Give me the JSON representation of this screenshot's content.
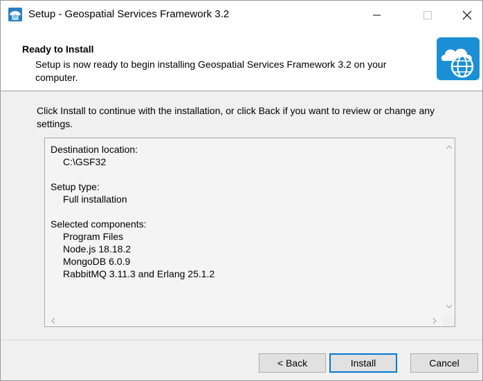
{
  "window": {
    "title": "Setup - Geospatial Services Framework 3.2",
    "icon": "installer-globe-icon"
  },
  "titlebar_buttons": {
    "minimize_icon": "minimize-icon",
    "maximize_icon": "maximize-icon",
    "close_icon": "close-icon"
  },
  "header": {
    "title": "Ready to Install",
    "description": "Setup is now ready to begin installing Geospatial Services Framework 3.2 on your computer.",
    "image": "cloud-globe-icon",
    "accent_color": "#1b8fd6"
  },
  "body": {
    "instruction": "Click Install to continue with the installation, or click Back if you want to review or change any settings."
  },
  "summary": {
    "destination_label": "Destination location:",
    "destination_value": "C:\\GSF32",
    "setup_type_label": "Setup type:",
    "setup_type_value": "Full installation",
    "components_label": "Selected components:",
    "components": [
      "Program Files",
      "Node.js 18.18.2",
      "MongoDB 6.0.9",
      "RabbitMQ 3.11.3 and Erlang 25.1.2"
    ]
  },
  "buttons": {
    "back": "< Back",
    "install": "Install",
    "cancel": "Cancel"
  },
  "colors": {
    "default_button_border": "#0078d7",
    "window_bg": "#f0f0f0"
  }
}
